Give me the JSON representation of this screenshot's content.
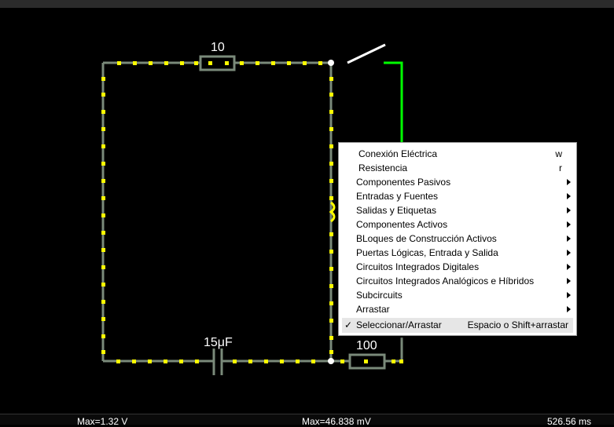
{
  "circuit": {
    "resistor_top_label": "10",
    "capacitor_label": "15μF",
    "resistor_bottom_label": "100",
    "colors": {
      "wire": "#7a8a7a",
      "current_dot": "#ffff00",
      "live_wire": "#00ff00",
      "node": "#ffffff"
    }
  },
  "scope": {
    "max_voltage_left": "Max=1.32 V",
    "max_voltage_middle": "Max=46.838 mV",
    "time_readout": "526.56 ms"
  },
  "context_menu": {
    "items": [
      {
        "label": "Conexión Eléctrica",
        "shortcut": "w"
      },
      {
        "label": "Resistencia",
        "shortcut": "r"
      },
      {
        "label": "Componentes Pasivos"
      },
      {
        "label": "Entradas y Fuentes"
      },
      {
        "label": "Salidas y Etiquetas"
      },
      {
        "label": "Componentes Activos"
      },
      {
        "label": "BLoques de Construcción Activos"
      },
      {
        "label": "Puertas Lógicas, Entrada y Salida"
      },
      {
        "label": "Circuitos Integrados Digitales"
      },
      {
        "label": "Circuitos Integrados Analógicos e Híbridos"
      },
      {
        "label": "Subcircuits"
      },
      {
        "label": "Arrastar"
      }
    ],
    "selected": {
      "check": "✓",
      "label": "Seleccionar/Arrastar",
      "shortcut": "Espacio o Shift+arrastar"
    }
  }
}
